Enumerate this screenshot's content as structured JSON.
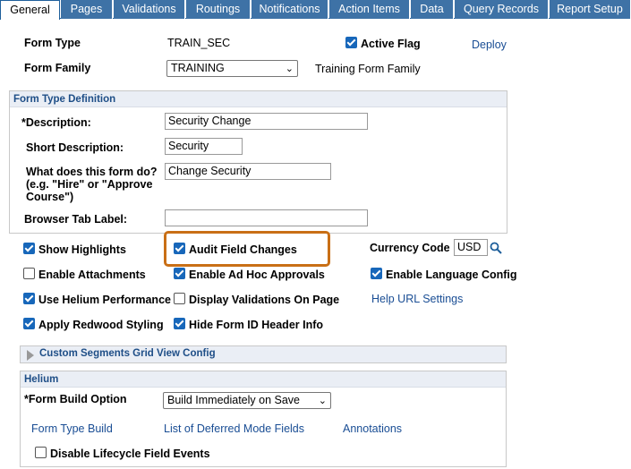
{
  "tabs": [
    {
      "label": "General",
      "active": true
    },
    {
      "label": "Pages"
    },
    {
      "label": "Validations"
    },
    {
      "label": "Routings"
    },
    {
      "label": "Notifications"
    },
    {
      "label": "Action Items"
    },
    {
      "label": "Data"
    },
    {
      "label": "Query Records"
    },
    {
      "label": "Report Setup"
    }
  ],
  "header": {
    "form_type_label": "Form Type",
    "form_type_value": "TRAIN_SEC",
    "active_flag_label": "Active Flag",
    "deploy_link": "Deploy",
    "form_family_label": "Form Family",
    "form_family_value": "TRAINING",
    "form_family_desc": "Training Form Family"
  },
  "definition": {
    "title": "Form Type Definition",
    "description_label": "*Description:",
    "description_value": "Security Change",
    "short_desc_label": "Short Description:",
    "short_desc_value": "Security",
    "what_label_1": "What does this form do?",
    "what_label_2": "(e.g. \"Hire\" or \"Approve",
    "what_label_3": "Course\")",
    "what_value": "Change Security",
    "browser_tab_label": "Browser Tab Label:",
    "browser_tab_value": ""
  },
  "options": {
    "show_highlights": "Show Highlights",
    "audit_field_changes": "Audit Field Changes",
    "currency_code_label": "Currency Code",
    "currency_code_value": "USD",
    "enable_attachments": "Enable Attachments",
    "enable_ad_hoc": "Enable Ad Hoc Approvals",
    "enable_language": "Enable Language Config",
    "use_helium": "Use Helium Performance",
    "display_validations": "Display Validations On Page",
    "help_url": "Help URL Settings",
    "apply_redwood": "Apply Redwood Styling",
    "hide_form_id": "Hide Form ID Header Info"
  },
  "custom_segments": {
    "title": "Custom Segments Grid View Config"
  },
  "helium": {
    "title": "Helium",
    "build_option_label": "*Form Build Option",
    "build_option_value": "Build Immediately on Save",
    "form_type_build": "Form Type Build",
    "deferred_fields": "List of Deferred Mode Fields",
    "annotations": "Annotations",
    "disable_lifecycle": "Disable Lifecycle Field Events"
  },
  "colors": {
    "tab": "#3e72a6",
    "link": "#194d94",
    "checkbox": "#1767ba",
    "highlight": "#c96f16"
  }
}
